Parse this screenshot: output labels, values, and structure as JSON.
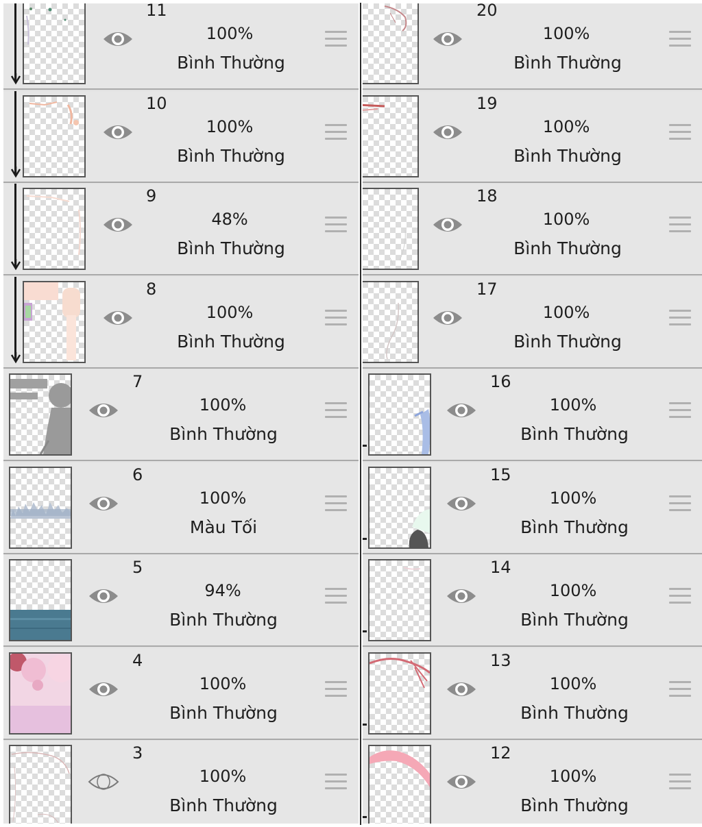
{
  "left_layers": [
    {
      "number": "11",
      "opacity": "100%",
      "blend": "Bình Thường",
      "visible": true,
      "clipped": true
    },
    {
      "number": "10",
      "opacity": "100%",
      "blend": "Bình Thường",
      "visible": true,
      "clipped": true
    },
    {
      "number": "9",
      "opacity": "48%",
      "blend": "Bình Thường",
      "visible": true,
      "clipped": true
    },
    {
      "number": "8",
      "opacity": "100%",
      "blend": "Bình Thường",
      "visible": true,
      "clipped": true
    },
    {
      "number": "7",
      "opacity": "100%",
      "blend": "Bình Thường",
      "visible": true,
      "clipped": false
    },
    {
      "number": "6",
      "opacity": "100%",
      "blend": "Màu Tối",
      "visible": true,
      "clipped": false
    },
    {
      "number": "5",
      "opacity": "94%",
      "blend": "Bình Thường",
      "visible": true,
      "clipped": false
    },
    {
      "number": "4",
      "opacity": "100%",
      "blend": "Bình Thường",
      "visible": true,
      "clipped": false
    },
    {
      "number": "3",
      "opacity": "100%",
      "blend": "Bình Thường",
      "visible": false,
      "clipped": false
    }
  ],
  "right_layers": [
    {
      "number": "20",
      "opacity": "100%",
      "blend": "Bình Thường",
      "visible": true,
      "clipped": true
    },
    {
      "number": "19",
      "opacity": "100%",
      "blend": "Bình Thường",
      "visible": true,
      "clipped": true
    },
    {
      "number": "18",
      "opacity": "100%",
      "blend": "Bình Thường",
      "visible": true,
      "clipped": true
    },
    {
      "number": "17",
      "opacity": "100%",
      "blend": "Bình Thường",
      "visible": true,
      "clipped": true
    },
    {
      "number": "16",
      "opacity": "100%",
      "blend": "Bình Thường",
      "visible": true,
      "clipped": false
    },
    {
      "number": "15",
      "opacity": "100%",
      "blend": "Bình Thường",
      "visible": true,
      "clipped": false
    },
    {
      "number": "14",
      "opacity": "100%",
      "blend": "Bình Thường",
      "visible": true,
      "clipped": false
    },
    {
      "number": "13",
      "opacity": "100%",
      "blend": "Bình Thường",
      "visible": true,
      "clipped": false
    },
    {
      "number": "12",
      "opacity": "100%",
      "blend": "Bình Thường",
      "visible": true,
      "clipped": false
    }
  ],
  "colors": {
    "row_bg": "#e6e6e6",
    "eye_icon": "#8c8c8c",
    "separator": "#a9a9a9",
    "text": "#1e1e1e"
  },
  "icons": {
    "visibility": "eye-icon",
    "hidden": "eye-hidden-icon",
    "reorder": "drag-handle-icon",
    "clipping": "clipping-arrow-icon"
  }
}
